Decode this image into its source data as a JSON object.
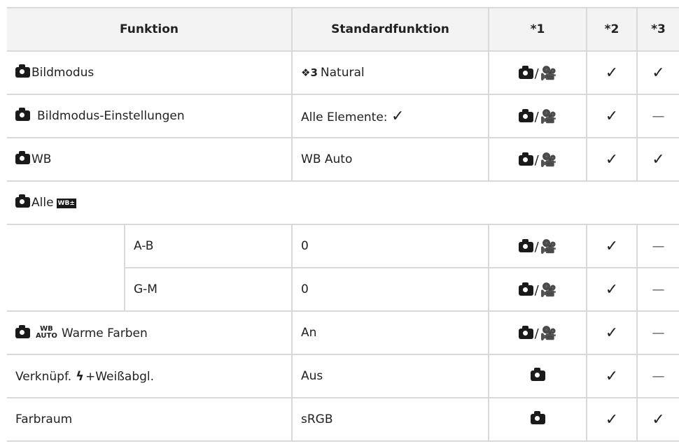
{
  "headers": [
    "Funktion",
    "Standardfunktion",
    "*1",
    "*2",
    "*3"
  ],
  "rows": [
    {
      "label": "Bildmodus",
      "value": "Natural",
      "value_prefix": "3",
      "scope": "photo-movie",
      "c2": "✓",
      "c3": "✓"
    },
    {
      "label": "Bildmodus-Einstellungen",
      "value": "Alle Elemente:",
      "value_suffix": "✓",
      "scope": "photo-movie",
      "c2": "✓",
      "c3": "—"
    },
    {
      "label": "WB",
      "value": "WB Auto",
      "scope": "photo-movie",
      "c2": "✓",
      "c3": "✓"
    },
    {
      "label": "Alle",
      "icon_text": "WB±"
    },
    {
      "sub_label": "A-B",
      "value": "0",
      "scope": "photo-movie",
      "c2": "✓",
      "c3": "—"
    },
    {
      "sub_label": "G-M",
      "value": "0",
      "scope": "photo-movie",
      "c2": "✓",
      "c3": "—"
    },
    {
      "label": "Warme Farben",
      "icon_top": "WB",
      "icon_bottom": "AUTO",
      "value": "An",
      "scope": "photo-movie",
      "c2": "✓",
      "c3": "—"
    },
    {
      "label": "Verknüpf.",
      "label_suffix": "+Weißabgl.",
      "value": "Aus",
      "scope": "photo",
      "c2": "✓",
      "c3": "—"
    },
    {
      "label": "Farbraum",
      "value": "sRGB",
      "scope": "photo",
      "c2": "✓",
      "c3": "✓"
    }
  ],
  "icons": {
    "camera": "camera-icon",
    "movie": "movie-camera-icon",
    "check": "checkmark-icon",
    "flash": "flash-icon",
    "picture_mode": "picture-mode-icon"
  },
  "colors": {
    "header_bg": "#f3f3f3",
    "border": "#d9d9d9",
    "text": "#222222"
  }
}
